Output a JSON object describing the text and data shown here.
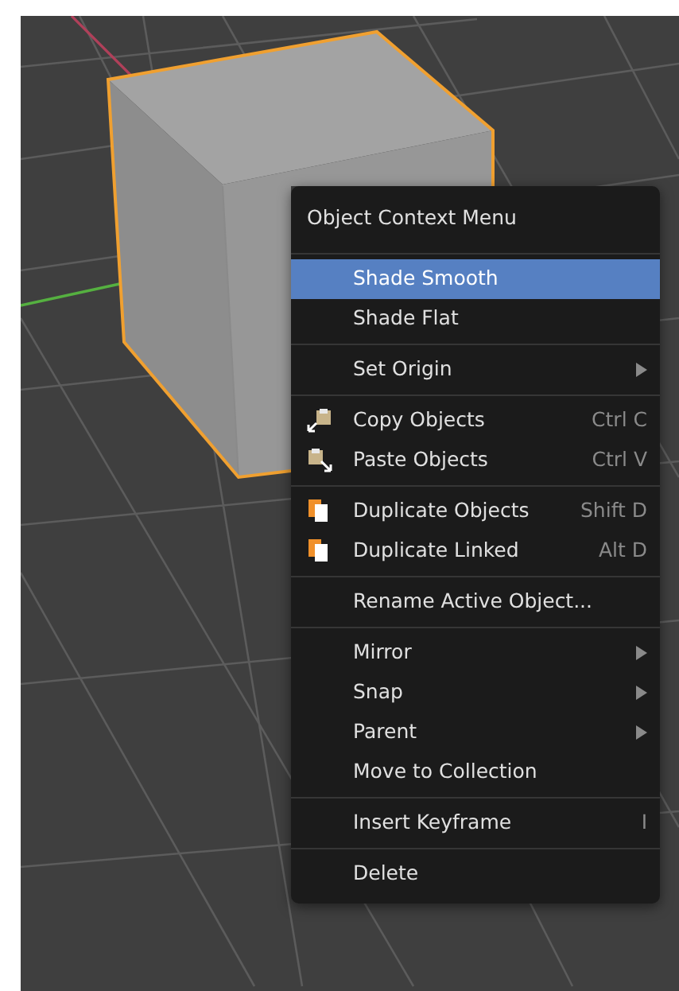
{
  "menu": {
    "title": "Object Context Menu",
    "sections": [
      [
        {
          "label": "Shade Smooth",
          "selected": true,
          "submenu": false
        },
        {
          "label": "Shade Flat",
          "selected": false,
          "submenu": false
        }
      ],
      [
        {
          "label": "Set Origin",
          "selected": false,
          "submenu": true
        }
      ],
      [
        {
          "label": "Copy Objects",
          "shortcut": "Ctrl C",
          "kind": "copy",
          "selected": false,
          "submenu": false
        },
        {
          "label": "Paste Objects",
          "shortcut": "Ctrl V",
          "kind": "paste",
          "selected": false,
          "submenu": false
        }
      ],
      [
        {
          "label": "Duplicate Objects",
          "shortcut": "Shift D",
          "kind": "duplicate",
          "selected": false,
          "submenu": false
        },
        {
          "label": "Duplicate Linked",
          "shortcut": "Alt D",
          "kind": "duplicate",
          "selected": false,
          "submenu": false
        }
      ],
      [
        {
          "label": "Rename Active Object...",
          "selected": false,
          "submenu": false
        }
      ],
      [
        {
          "label": "Mirror",
          "selected": false,
          "submenu": true
        },
        {
          "label": "Snap",
          "selected": false,
          "submenu": true
        },
        {
          "label": "Parent",
          "selected": false,
          "submenu": true
        },
        {
          "label": "Move to Collection",
          "selected": false,
          "submenu": false
        }
      ],
      [
        {
          "label": "Insert Keyframe",
          "shortcut": "I",
          "selected": false,
          "submenu": false
        }
      ],
      [
        {
          "label": "Delete",
          "selected": false,
          "submenu": false
        }
      ]
    ]
  }
}
